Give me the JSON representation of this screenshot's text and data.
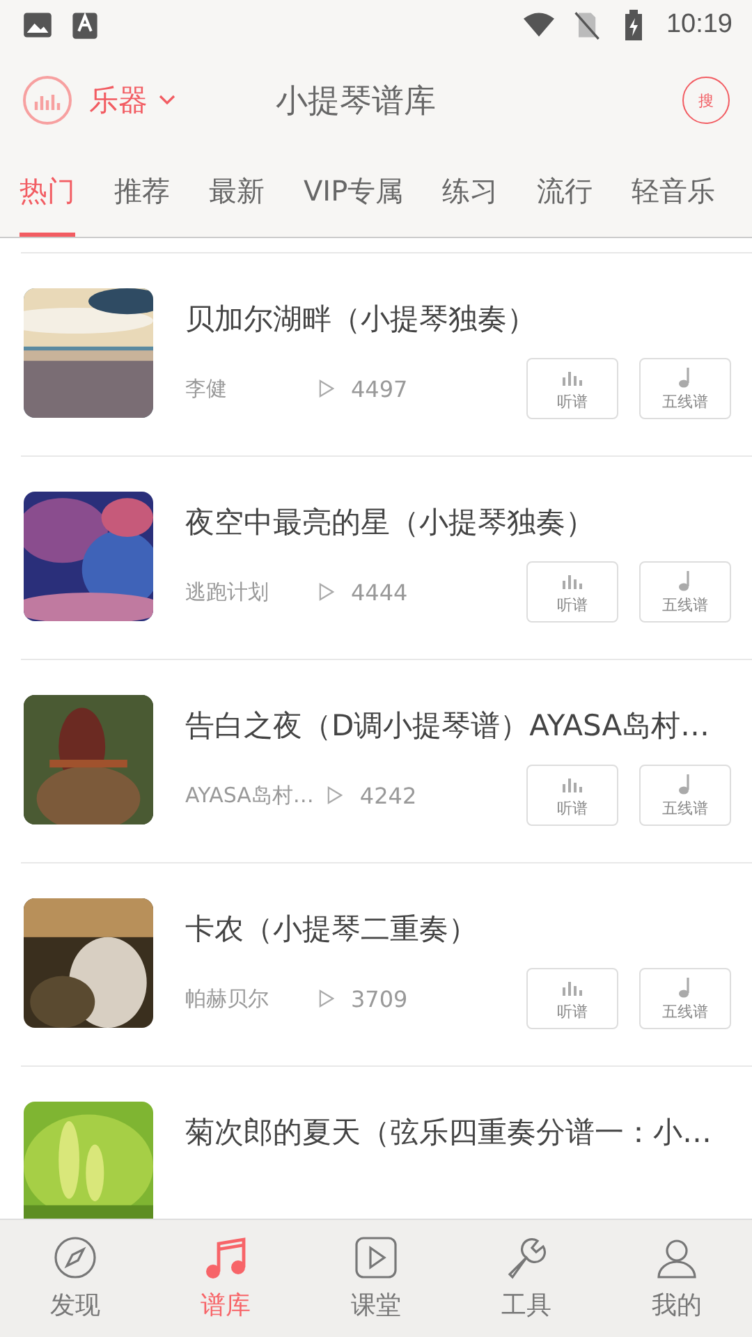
{
  "status_bar": {
    "time": "10:19"
  },
  "header": {
    "instrument": "乐器",
    "title": "小提琴谱库",
    "search_label": "搜"
  },
  "tabs": [
    {
      "label": "热门",
      "selected": true
    },
    {
      "label": "推荐",
      "selected": false
    },
    {
      "label": "最新",
      "selected": false
    },
    {
      "label": "VIP专属",
      "selected": false
    },
    {
      "label": "练习",
      "selected": false
    },
    {
      "label": "流行",
      "selected": false
    },
    {
      "label": "轻音乐",
      "selected": false
    }
  ],
  "songs": [
    {
      "title": "贝加尔湖畔（小提琴独奏）",
      "artist": "李健",
      "plays": "4497",
      "buttons": [
        "听谱",
        "五线谱"
      ]
    },
    {
      "title": "夜空中最亮的星（小提琴独奏）",
      "artist": "逃跑计划",
      "plays": "4444",
      "buttons": [
        "听谱",
        "五线谱"
      ]
    },
    {
      "title": "告白之夜（D调小提琴谱）AYASA岛村…",
      "artist": "AYASA岛村…",
      "plays": "4242",
      "buttons": [
        "听谱",
        "五线谱"
      ]
    },
    {
      "title": "卡农（小提琴二重奏）",
      "artist": "帕赫贝尔",
      "plays": "3709",
      "buttons": [
        "听谱",
        "五线谱"
      ]
    },
    {
      "title": "菊次郎的夏天（弦乐四重奏分谱一：小…"
    }
  ],
  "bottom_nav": [
    {
      "label": "发现",
      "selected": false
    },
    {
      "label": "谱库",
      "selected": true
    },
    {
      "label": "课堂",
      "selected": false
    },
    {
      "label": "工具",
      "selected": false
    },
    {
      "label": "我的",
      "selected": false
    }
  ]
}
